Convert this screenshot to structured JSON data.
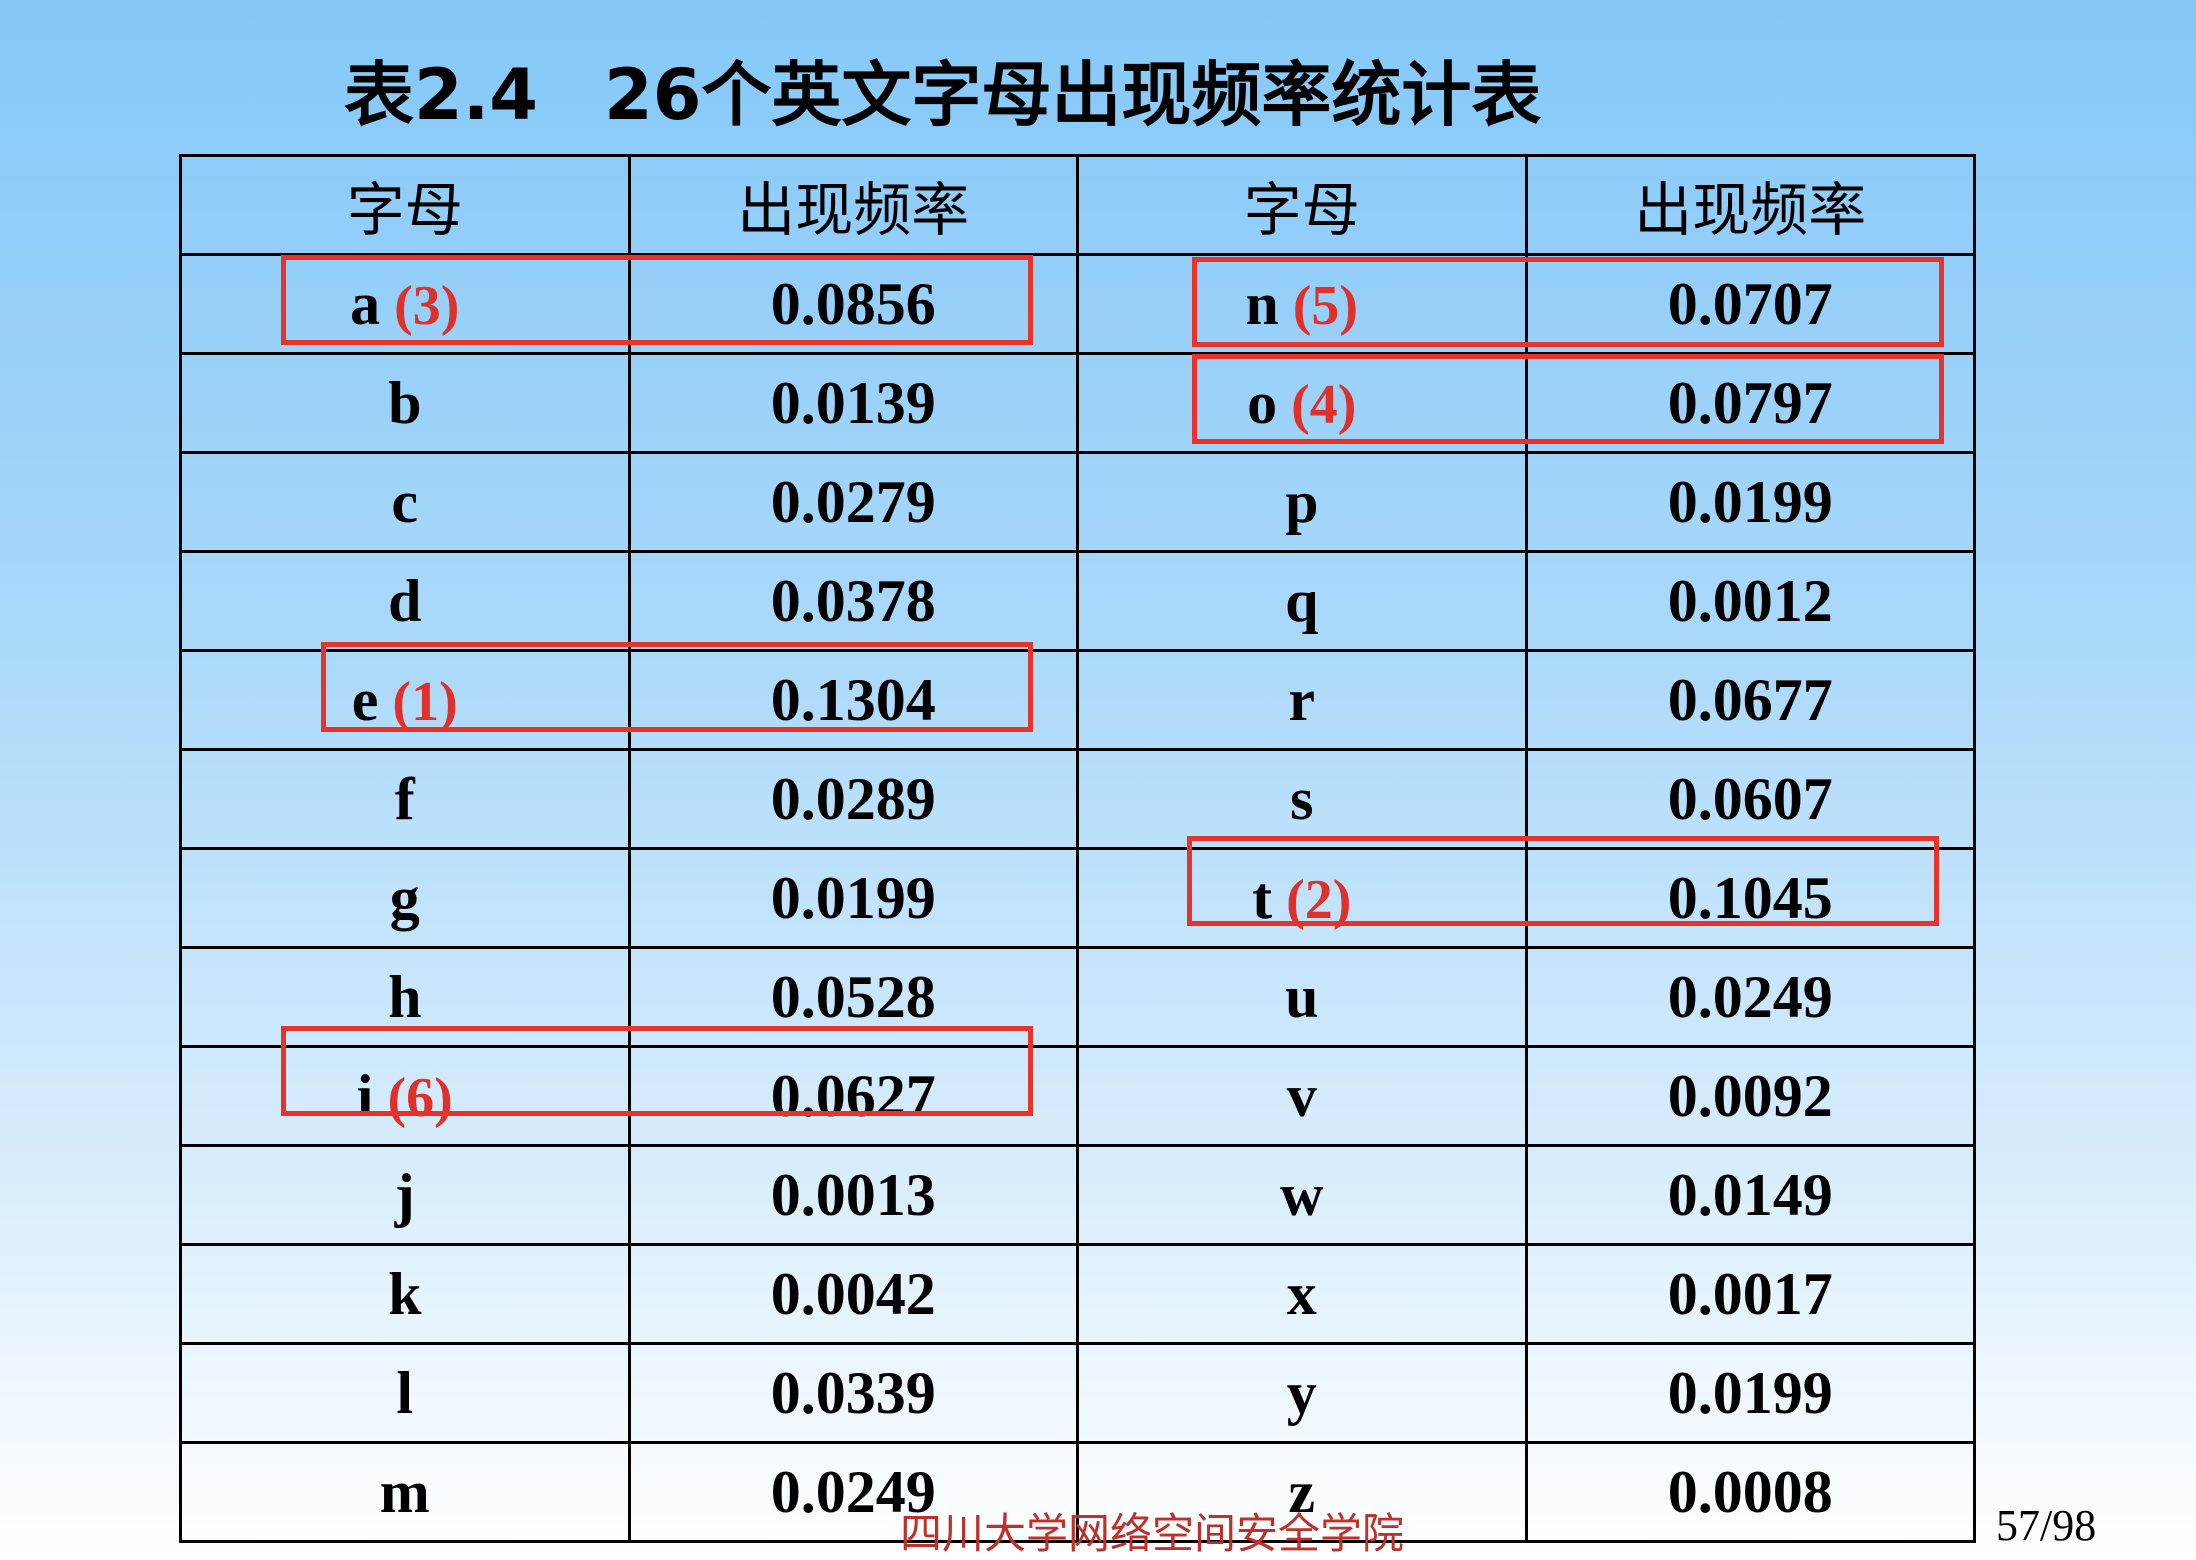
{
  "title": {
    "number": "表2.4",
    "text": "26个英文字母出现频率统计表"
  },
  "table": {
    "headers": [
      "字母",
      "出现频率",
      "字母",
      "出现频率"
    ],
    "rows": [
      {
        "l1": "a",
        "r1": "(3)",
        "f1": "0.0856",
        "l2": "n",
        "r2": "(5)",
        "f2": "0.0707"
      },
      {
        "l1": "b",
        "r1": "",
        "f1": "0.0139",
        "l2": "o",
        "r2": "(4)",
        "f2": "0.0797"
      },
      {
        "l1": "c",
        "r1": "",
        "f1": "0.0279",
        "l2": "p",
        "r2": "",
        "f2": "0.0199"
      },
      {
        "l1": "d",
        "r1": "",
        "f1": "0.0378",
        "l2": "q",
        "r2": "",
        "f2": "0.0012"
      },
      {
        "l1": "e",
        "r1": "(1)",
        "f1": "0.1304",
        "l2": "r",
        "r2": "",
        "f2": "0.0677"
      },
      {
        "l1": "f",
        "r1": "",
        "f1": "0.0289",
        "l2": "s",
        "r2": "",
        "f2": "0.0607"
      },
      {
        "l1": "g",
        "r1": "",
        "f1": "0.0199",
        "l2": "t",
        "r2": "(2)",
        "f2": "0.1045"
      },
      {
        "l1": "h",
        "r1": "",
        "f1": "0.0528",
        "l2": "u",
        "r2": "",
        "f2": "0.0249"
      },
      {
        "l1": "i",
        "r1": "(6)",
        "f1": "0.0627",
        "l2": "v",
        "r2": "",
        "f2": "0.0092"
      },
      {
        "l1": "j",
        "r1": "",
        "f1": "0.0013",
        "l2": "w",
        "r2": "",
        "f2": "0.0149"
      },
      {
        "l1": "k",
        "r1": "",
        "f1": "0.0042",
        "l2": "x",
        "r2": "",
        "f2": "0.0017"
      },
      {
        "l1": "l",
        "r1": "",
        "f1": "0.0339",
        "l2": "y",
        "r2": "",
        "f2": "0.0199"
      },
      {
        "l1": "m",
        "r1": "",
        "f1": "0.0249",
        "l2": "z",
        "r2": "",
        "f2": "0.0008"
      }
    ]
  },
  "highlight_color": "#e8332a",
  "footer": "四川大学网络空间安全学院",
  "page_number": "57/98"
}
